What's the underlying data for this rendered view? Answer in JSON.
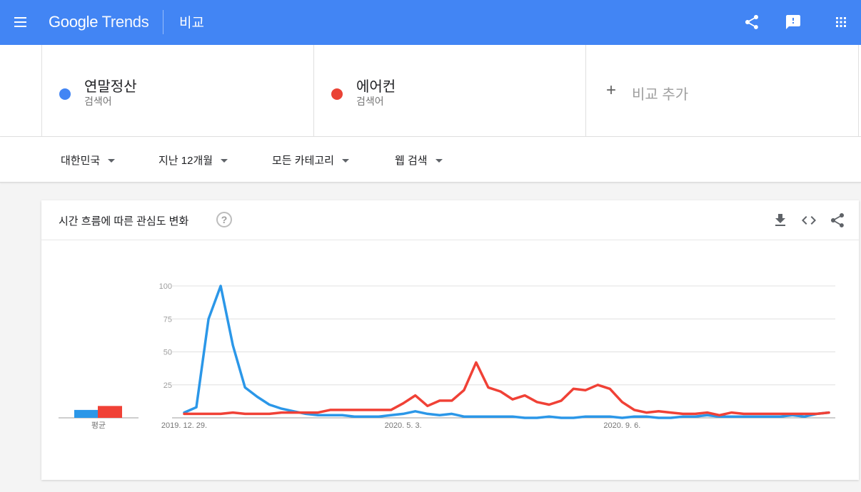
{
  "header": {
    "logo_google": "Google",
    "logo_trends": "Trends",
    "page_title": "비교",
    "icons": [
      "menu-icon",
      "share-icon",
      "feedback-icon",
      "apps-grid-icon"
    ],
    "bar_color": "#4285f4"
  },
  "terms": [
    {
      "name": "연말정산",
      "type": "검색어",
      "color": "#4285f4"
    },
    {
      "name": "에어컨",
      "type": "검색어",
      "color": "#ea4335"
    }
  ],
  "add_compare": {
    "icon": "plus-icon",
    "label": "비교 추가"
  },
  "filters": {
    "region": "대한민국",
    "period": "지난 12개월",
    "category": "모든 카테고리",
    "search_type": "웹 검색"
  },
  "card": {
    "title": "시간 흐름에 따른 관심도 변화",
    "help": "?",
    "icons": [
      "download-icon",
      "embed-code-icon",
      "share-icon"
    ]
  },
  "chart_data": {
    "type": "line",
    "ylim": [
      0,
      100
    ],
    "yticks": [
      "100",
      "75",
      "50",
      "25"
    ],
    "grid": true,
    "x_labels": [
      {
        "label": "2019. 12. 29.",
        "index": 0
      },
      {
        "label": "2020. 5. 3.",
        "index": 18
      },
      {
        "label": "2020. 9. 6.",
        "index": 36
      }
    ],
    "average_label": "평균",
    "averages": [
      6,
      9
    ],
    "series": [
      {
        "color": "#2b97e8",
        "values": [
          4,
          8,
          75,
          100,
          55,
          23,
          16,
          10,
          7,
          5,
          3,
          2,
          2,
          2,
          1,
          1,
          1,
          2,
          3,
          5,
          3,
          2,
          3,
          1,
          1,
          1,
          1,
          1,
          0,
          0,
          1,
          0,
          0,
          1,
          1,
          1,
          0,
          1,
          1,
          0,
          0,
          1,
          1,
          2,
          1,
          1,
          1,
          1,
          1,
          1,
          2,
          1,
          3,
          4
        ]
      },
      {
        "color": "#f04136",
        "values": [
          3,
          3,
          3,
          3,
          4,
          3,
          3,
          3,
          4,
          4,
          4,
          4,
          6,
          6,
          6,
          6,
          6,
          6,
          11,
          17,
          9,
          13,
          13,
          21,
          42,
          23,
          20,
          14,
          17,
          12,
          10,
          13,
          22,
          21,
          25,
          22,
          12,
          6,
          4,
          5,
          4,
          3,
          3,
          4,
          2,
          4,
          3,
          3,
          3,
          3,
          3,
          3,
          3,
          4
        ]
      }
    ]
  }
}
